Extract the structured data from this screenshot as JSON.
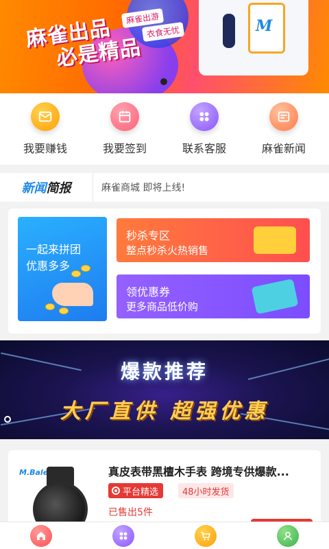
{
  "banner": {
    "title_line1": "麻雀出品",
    "title_line2": "必是精品",
    "tag1": "麻雀出游",
    "tag2": "衣食无忧",
    "phone_logo": "M"
  },
  "quick_actions": [
    {
      "label": "我要赚钱",
      "icon": "envelope-icon",
      "color": "#ffb21a"
    },
    {
      "label": "我要签到",
      "icon": "calendar-icon",
      "color": "#ff6f83"
    },
    {
      "label": "联系客服",
      "icon": "grid-icon",
      "color": "#9c6bff"
    },
    {
      "label": "麻雀新闻",
      "icon": "news-icon",
      "color": "#ff8a5c"
    }
  ],
  "news": {
    "logo_part1": "新闻",
    "logo_part2": "简报",
    "text": "麻雀商城 即将上线!"
  },
  "promo": {
    "left_line1": "一起来拼团",
    "left_line2": "优惠多多",
    "flash_title": "秒杀专区",
    "flash_sub": "整点秒杀火热销售",
    "coupon_title": "领优惠券",
    "coupon_sub": "更多商品低价购"
  },
  "hot_banner": {
    "title": "爆款推荐",
    "subtitle": "大厂直供 超强优惠"
  },
  "product": {
    "name": "真皮表带黑檀木手表 跨境专供爆款...",
    "brand": "M.Bale",
    "tag_platform": "平台精选",
    "tag_shipping": "48小时发货",
    "sold": "已售出5件"
  },
  "bottom_nav": [
    {
      "name": "home",
      "icon": "home-icon",
      "color": "#ff5a5a"
    },
    {
      "name": "category",
      "icon": "grid-icon",
      "color": "#9c6bff"
    },
    {
      "name": "cart",
      "icon": "cart-icon",
      "color": "#ffb21a"
    },
    {
      "name": "profile",
      "icon": "user-icon",
      "color": "#4cc05b"
    }
  ]
}
